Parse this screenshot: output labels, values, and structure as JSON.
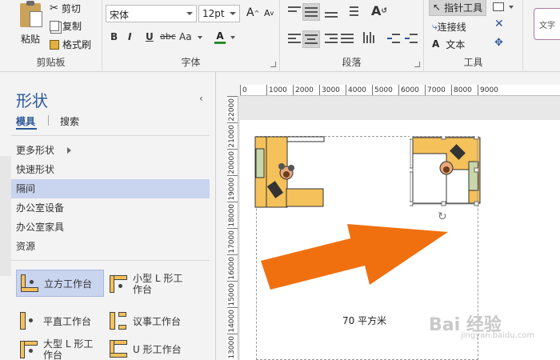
{
  "ribbon": {
    "clipboard": {
      "paste": "粘贴",
      "cut": "剪切",
      "copy": "复制",
      "format_painter": "格式刷",
      "label": "剪贴板"
    },
    "font": {
      "font_name": "宋体",
      "font_size": "12pt",
      "grow": "A",
      "shrink": "A",
      "bold": "B",
      "italic": "I",
      "underline": "U",
      "strike": "abc",
      "case": "Aa",
      "color": "A",
      "label": "字体"
    },
    "paragraph": {
      "label": "段落"
    },
    "tools": {
      "pointer": "指针工具",
      "connector": "连接线",
      "text": "文本",
      "text_icon": "A",
      "label": "工具"
    },
    "style_preview": "文字"
  },
  "shapes_pane": {
    "title": "形状",
    "collapse": "‹",
    "tabs": [
      "模具",
      "搜索"
    ],
    "menu": [
      "更多形状",
      "快速形状",
      "隔间",
      "办公室设备",
      "办公室家具",
      "资源"
    ],
    "selected_menu_index": 2,
    "stencils": [
      "立方工作台",
      "小型 L 形工\n作台",
      "平直工作台",
      "议事工作台",
      "大型 L 形工\n作台",
      "U 形工作台"
    ]
  },
  "ruler": {
    "horizontal": [
      "0",
      "1000",
      "2000",
      "3000",
      "4000",
      "5000",
      "6000",
      "7000",
      "8000",
      "9000"
    ],
    "vertical": [
      "22000",
      "21000",
      "20000",
      "19000",
      "18000",
      "17000",
      "16000",
      "15000",
      "14000",
      "13000"
    ]
  },
  "canvas": {
    "area_label": "70  平方米"
  },
  "watermark": {
    "text": "Bai 经验",
    "sub": "jingyan.baidu.com"
  },
  "colors": {
    "accent": "#2b579a",
    "selection": "#c9d4ef",
    "desk": "#f5c15a",
    "arrow": "#f07010"
  }
}
